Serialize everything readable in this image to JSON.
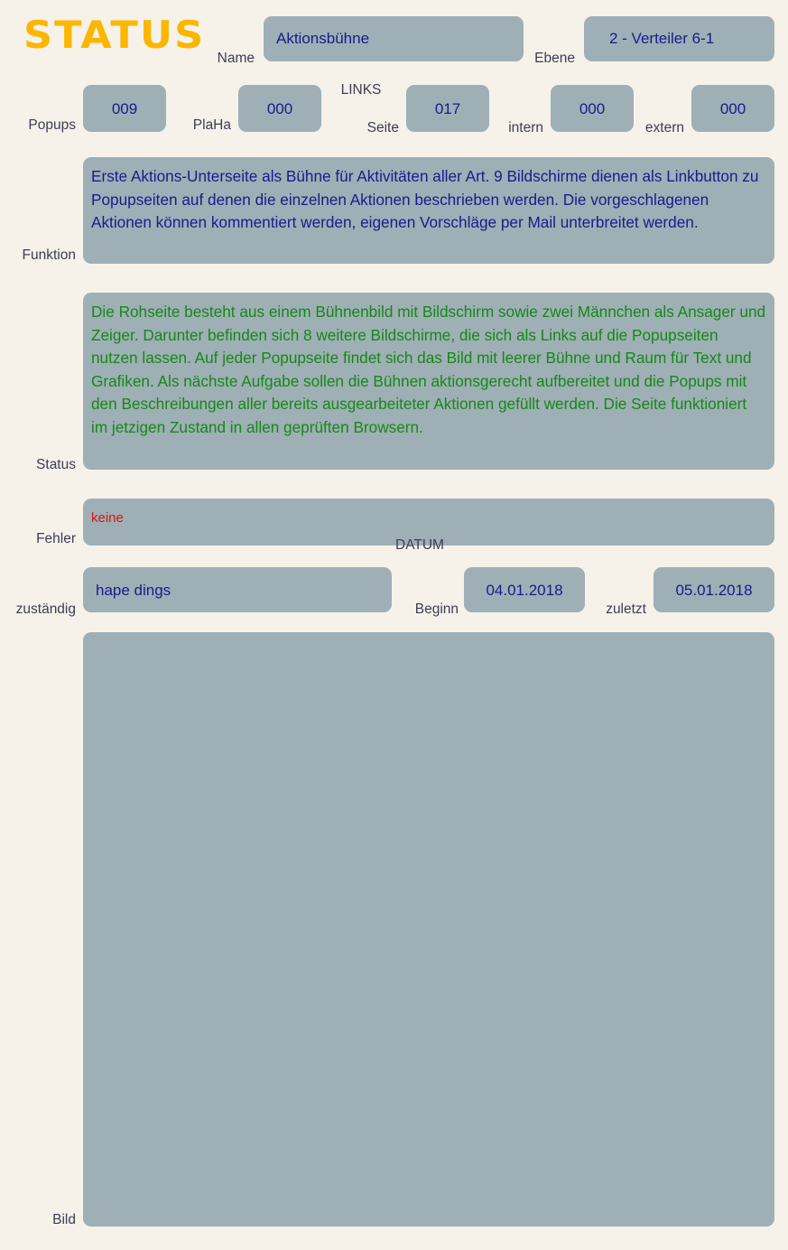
{
  "title": "STATUS",
  "header": {
    "name_label": "Name",
    "name_value": "Aktionsbühne",
    "ebene_label": "Ebene",
    "ebene_value": "2 - Verteiler 6-1"
  },
  "counters": {
    "links_group_label": "LINKS",
    "popups_label": "Popups",
    "popups_value": "009",
    "plaha_label": "PlaHa",
    "plaha_value": "000",
    "seite_label": "Seite",
    "seite_value": "017",
    "intern_label": "intern",
    "intern_value": "000",
    "extern_label": "extern",
    "extern_value": "000"
  },
  "funktion": {
    "label": "Funktion",
    "text": "Erste Aktions-Unterseite als Bühne für Aktivitäten aller Art. 9 Bildschirme dienen als Linkbutton zu Popupseiten auf denen die einzelnen Aktionen beschrieben werden. Die vorgeschlagenen Aktionen können kommentiert werden, eigenen Vorschläge per Mail unterbreitet werden."
  },
  "status": {
    "label": "Status",
    "text": "Die Rohseite besteht aus einem Bühnenbild mit Bildschirm sowie zwei Männchen als Ansager und Zeiger. Darunter befinden sich 8 weitere Bildschirme, die sich als Links auf die Popupseiten nutzen lassen. Auf jeder Popupseite findet sich das Bild mit leerer Bühne und Raum für Text und Grafiken. Als nächste Aufgabe sollen die Bühnen aktionsgerecht aufbereitet und die Popups mit den Beschreibungen aller bereits ausgearbeiteter Aktionen gefüllt werden. Die Seite funktioniert im jetzigen Zustand in allen geprüften Browsern."
  },
  "fehler": {
    "label": "Fehler",
    "text": "keine"
  },
  "zustaendig": {
    "label": "zuständig",
    "value": "hape dings",
    "datum_group_label": "DATUM",
    "beginn_label": "Beginn",
    "beginn_value": "04.01.2018",
    "zuletzt_label": "zuletzt",
    "zuletzt_value": "05.01.2018"
  },
  "bild": {
    "label": "Bild"
  },
  "colors": {
    "background": "#f6f2e9",
    "panel": "#9fafb6",
    "title": "#fbb600",
    "value_text": "#1a1a8c",
    "label_text": "#3e3c56",
    "status_text": "#138a13",
    "error_text": "#d01717"
  }
}
